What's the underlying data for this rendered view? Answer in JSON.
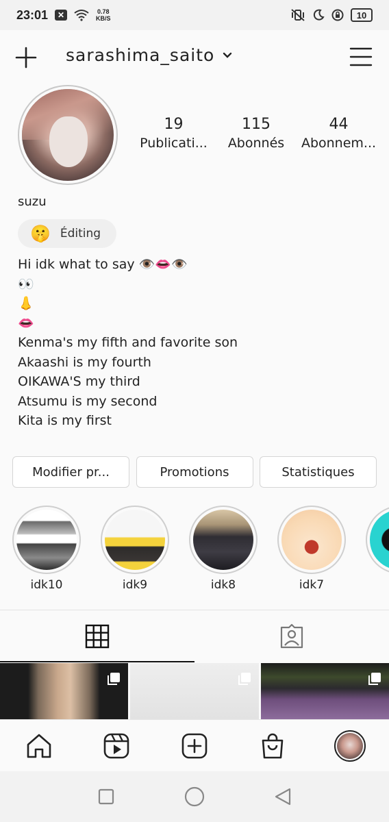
{
  "status_bar": {
    "time": "23:01",
    "notif_icon": "x-box-icon",
    "speed_value": "0.78",
    "speed_unit": "KB/S",
    "battery": "10"
  },
  "header": {
    "username": "sarashima_saito"
  },
  "profile": {
    "stats": [
      {
        "value": "19",
        "label": "Publicati..."
      },
      {
        "value": "115",
        "label": "Abonnés"
      },
      {
        "value": "44",
        "label": "Abonnem..."
      }
    ],
    "display_name": "suzu",
    "category": {
      "emoji": "🤫",
      "label": "Éditing"
    },
    "bio_lines": [
      "Hi idk what to say 👁️👄👁️",
      "👀",
      "👃",
      "👄",
      "Kenma's my fifth and favorite son",
      "Akaashi is my fourth",
      "OIKAWA'S my third",
      "Atsumu is my second",
      "Kita is my first"
    ]
  },
  "actions": {
    "edit": "Modifier pr...",
    "promotions": "Promotions",
    "stats": "Statistiques"
  },
  "highlights": [
    {
      "label": "idk10"
    },
    {
      "label": "idk9"
    },
    {
      "label": "idk8"
    },
    {
      "label": "idk7"
    },
    {
      "label": ""
    }
  ],
  "colors": {
    "background": "#fafafa",
    "text": "#262626",
    "border": "#d5d5d5",
    "accent": "#111111"
  }
}
